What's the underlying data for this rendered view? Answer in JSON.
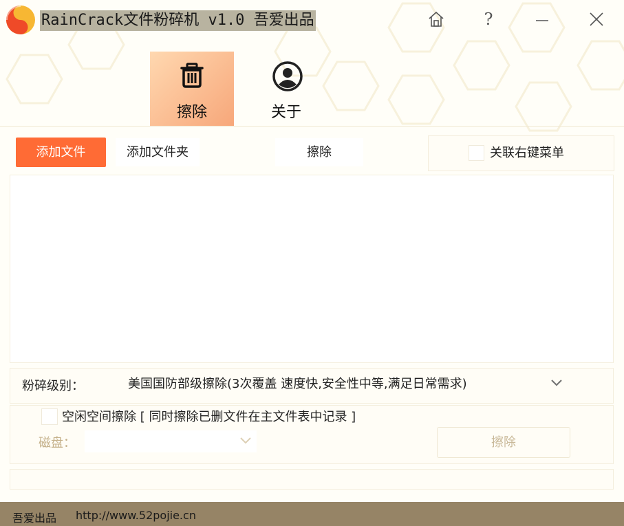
{
  "window": {
    "title": "RainCrack文件粉碎机 v1.0 吾爱出品",
    "help_label": "?"
  },
  "tabs": [
    {
      "label": "擦除",
      "icon": "trash-icon",
      "active": true
    },
    {
      "label": "关于",
      "icon": "user-icon",
      "active": false
    }
  ],
  "toolbar": {
    "add_file_label": "添加文件",
    "add_folder_label": "添加文件夹",
    "erase_label": "擦除",
    "context_menu_label": "关联右键菜单"
  },
  "file_list": {
    "items": []
  },
  "shred_level": {
    "label": "粉碎级别：",
    "selected": "美国国防部级擦除(3次覆盖 速度快,安全性中等,满足日常需求)"
  },
  "free_space": {
    "label": "空闲空间擦除 [ 同时擦除已删文件在主文件表中记录 ]",
    "disk_label": "磁盘：",
    "disk_selected": "",
    "erase_label": "擦除"
  },
  "footer": {
    "brand": "吾爱出品",
    "url": "http://www.52pojie.cn"
  },
  "colors": {
    "accent": "#ff6b35",
    "active_tab_gradient_start": "#ffd8b0",
    "active_tab_gradient_end": "#f7a77a",
    "footer_bg": "#968466",
    "disabled_text": "#c9b999"
  }
}
